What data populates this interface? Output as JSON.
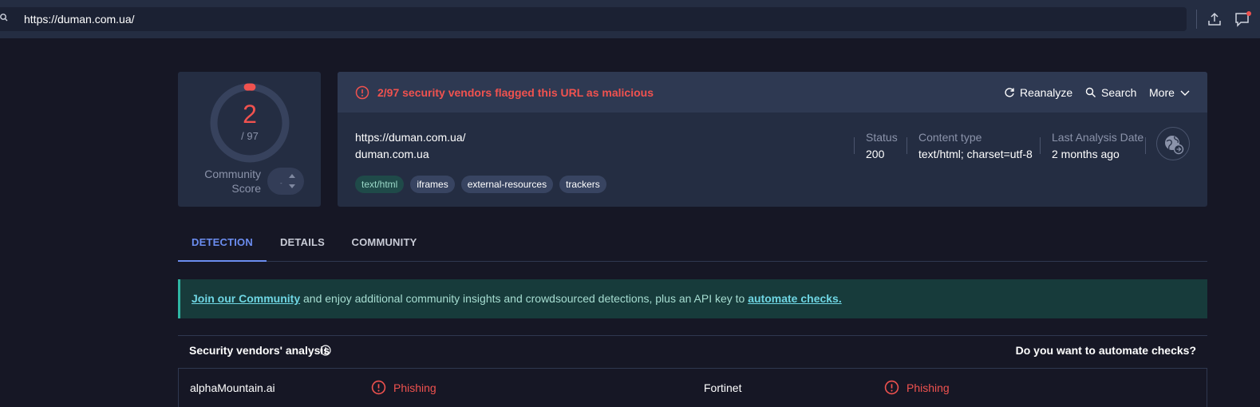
{
  "browser": {
    "url": "https://duman.com.ua/"
  },
  "score": {
    "detections": "2",
    "total": "/ 97",
    "community_label": "Community Score",
    "community_value": "-",
    "detection_fraction": 0.0206
  },
  "header": {
    "alert": "2/97 security vendors flagged this URL as malicious",
    "reanalyze": "Reanalyze",
    "search": "Search",
    "more": "More"
  },
  "info": {
    "url": "https://duman.com.ua/",
    "domain": "duman.com.ua",
    "tags": [
      "text/html",
      "iframes",
      "external-resources",
      "trackers"
    ],
    "status_label": "Status",
    "status_value": "200",
    "content_type_label": "Content type",
    "content_type_value": "text/html; charset=utf-8",
    "last_analysis_label": "Last Analysis Date",
    "last_analysis_value": "2 months ago"
  },
  "tabs": [
    "DETECTION",
    "DETAILS",
    "COMMUNITY"
  ],
  "banner": {
    "link1": "Join our Community",
    "middle": " and enjoy additional community insights and crowdsourced detections, plus an API key to ",
    "link2": "automate checks."
  },
  "vendors": {
    "title": "Security vendors' analysis",
    "automate": "Do you want to automate checks?",
    "rows": [
      {
        "left_name": "alphaMountain.ai",
        "left_result": "Phishing",
        "right_name": "Fortinet",
        "right_result": "Phishing"
      }
    ]
  },
  "colors": {
    "malicious": "#f0524f",
    "accent": "#6b8df0",
    "banner_bg": "#173b3b"
  }
}
